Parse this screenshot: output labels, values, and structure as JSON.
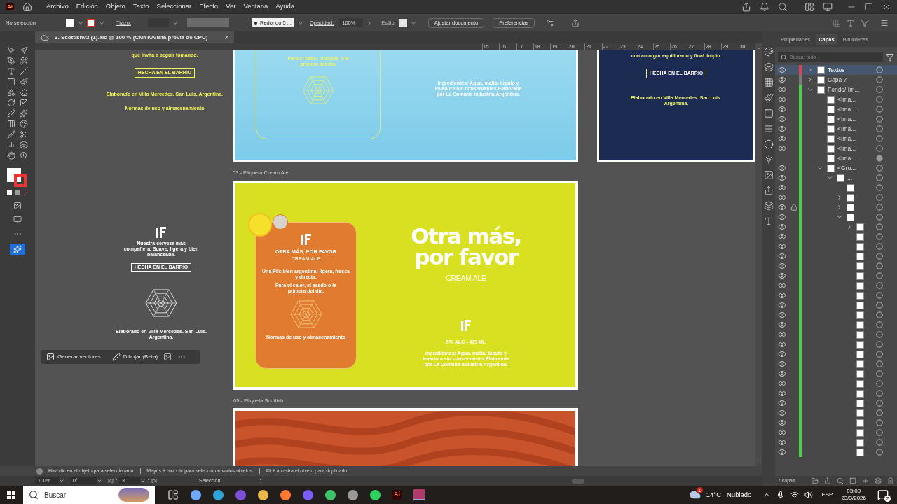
{
  "app_logo": "Ai",
  "menu": [
    "Archivo",
    "Edición",
    "Objeto",
    "Texto",
    "Seleccionar",
    "Efecto",
    "Ver",
    "Ventana",
    "Ayuda"
  ],
  "control_bar": {
    "selection": "No selección",
    "stroke_label": "Trazo:",
    "brush": "Redondo 5 ...",
    "opacity_label": "Opacidad:",
    "opacity": "100%",
    "style_label": "Estilo:",
    "buttons": [
      "Ajustar documento",
      "Preferencias"
    ]
  },
  "document_tab": {
    "title": "3. Scottishv2 (1).aic @ 100 % (CMYK/Vista previa de CPU)",
    "close": "×"
  },
  "ruler": [
    "15",
    "16",
    "17",
    "18",
    "19",
    "20",
    "21",
    "22",
    "23",
    "24",
    "25",
    "26",
    "27",
    "28",
    "29",
    "30"
  ],
  "canvas": {
    "side_top": {
      "tagline": "que invita a seguir tomando.",
      "badge": "HECHA EN EL BARRIO",
      "origin": "Elaborado en Villa Mercedes. San Luis. Argentina.",
      "storage_title": "Normas de uso y almacenamiento"
    },
    "side_bottom": {
      "lines": "Nuestra cerveza más compañera. Suave, ligera y bien balanceada.",
      "badge": "HECHA EN EL BARRIO",
      "origin": "Elaborado en Villa Mercedes. San Luis. Argentina."
    },
    "sky": {
      "card_text": "Para el calor, el asado o la primera del día.",
      "ingredients": "Ingredientes: Agua, malta, lúpulo y levadura sin conservantes Elaborada por La Comuna Industria Argentina."
    },
    "night": {
      "tagline": "con amargor equilibrado y final limpio.",
      "badge": "HECHA EN EL BARRIO",
      "origin": "Elaborado en Villa Mercedes. San Luis. Argentina."
    },
    "artboard_labels": [
      "03 - Etiqueta Cream Ale",
      "05 - Etiqueta Scottish"
    ],
    "cream_ale": {
      "card_title": "OTRA MÁS, POR FAVOR",
      "card_subtitle": "CREAM ALE",
      "description": "Una Pils bien argentina: ligera, fresca y directa.",
      "pairing": "Para el calor, el asado o la primera del día.",
      "storage_title": "Normas de uso y almacenamiento",
      "headline": "Otra más, por favor",
      "style": "CREAM ALE",
      "specs": "5% ALC • 473 ML",
      "ingredients": "Ingredientes: Agua, malta, lúpulo y levadura sin conservantes Elaborada por La Comuna Industria Argentina."
    }
  },
  "task_bar": {
    "generate": "Generar vectores",
    "draw": "Dibujar (Beta)"
  },
  "panel": {
    "tabs": [
      {
        "label": "Propiedades",
        "selected": false
      },
      {
        "label": "Capas",
        "selected": true
      },
      {
        "label": "Bibliotecas",
        "selected": false
      }
    ],
    "search": {
      "placeholder": "Buscar todo"
    },
    "layers": [
      {
        "name": "Textos",
        "color": "#d9434f",
        "selected": true,
        "visible": true,
        "locked": false,
        "expanded": false
      },
      {
        "name": "Capa 7",
        "color": "#7a7a7a",
        "selected": false,
        "visible": true,
        "locked": false,
        "expanded": false
      },
      {
        "name": "Fondo/ Im...",
        "color": "#4cd14c",
        "selected": false,
        "visible": true,
        "locked": false,
        "expanded": true,
        "children": [
          {
            "name": "<Ima...",
            "selected": false,
            "visible": true,
            "locked": false
          },
          {
            "name": "<Ima...",
            "selected": false,
            "visible": true,
            "locked": false
          },
          {
            "name": "<Ima...",
            "selected": false,
            "visible": true,
            "locked": false
          },
          {
            "name": "<Ima...",
            "selected": false,
            "visible": true,
            "locked": false
          },
          {
            "name": "<Ima...",
            "selected": false,
            "visible": true,
            "locked": false
          },
          {
            "name": "<Ima...",
            "selected": false,
            "visible": true,
            "locked": false
          },
          {
            "name": "<Ima...",
            "selected": false,
            "visible": false,
            "locked": false
          },
          {
            "name": "<Gru...",
            "selected": false,
            "visible": true,
            "locked": false,
            "expanded": true,
            "children": [
              {
                "name": "...",
                "selected": false,
                "visible": true,
                "locked": false,
                "expanded": true,
                "children": [
                  {
                    "selected": false,
                    "visible": true,
                    "locked": false
                  },
                  {
                    "selected": false,
                    "visible": true,
                    "locked": false,
                    "expanded": false
                  },
                  {
                    "selected": false,
                    "visible": true,
                    "locked": true,
                    "expanded": false
                  },
                  {
                    "selected": false,
                    "visible": true,
                    "locked": false,
                    "expanded": true,
                    "children": [
                      {
                        "selected": false,
                        "visible": true,
                        "locked": false,
                        "expanded": false
                      },
                      {
                        "selected": false,
                        "visible": true,
                        "locked": false
                      },
                      {
                        "selected": false,
                        "visible": true,
                        "locked": false
                      },
                      {
                        "selected": false,
                        "visible": true,
                        "locked": false
                      },
                      {
                        "selected": false,
                        "visible": true,
                        "locked": false
                      },
                      {
                        "selected": false,
                        "visible": true,
                        "locked": false
                      },
                      {
                        "selected": false,
                        "visible": true,
                        "locked": false
                      },
                      {
                        "selected": false,
                        "visible": true,
                        "locked": false
                      },
                      {
                        "selected": false,
                        "visible": true,
                        "locked": false
                      },
                      {
                        "selected": false,
                        "visible": true,
                        "locked": false
                      },
                      {
                        "selected": false,
                        "visible": true,
                        "locked": false
                      },
                      {
                        "selected": false,
                        "visible": true,
                        "locked": false
                      },
                      {
                        "selected": false,
                        "visible": true,
                        "locked": false
                      },
                      {
                        "selected": false,
                        "visible": true,
                        "locked": false
                      },
                      {
                        "selected": false,
                        "visible": true,
                        "locked": false
                      },
                      {
                        "selected": false,
                        "visible": true,
                        "locked": false
                      },
                      {
                        "selected": false,
                        "visible": true,
                        "locked": false
                      },
                      {
                        "selected": false,
                        "visible": true,
                        "locked": false
                      },
                      {
                        "selected": false,
                        "visible": true,
                        "locked": false
                      },
                      {
                        "selected": false,
                        "visible": true,
                        "locked": false
                      },
                      {
                        "selected": false,
                        "visible": true,
                        "locked": false
                      },
                      {
                        "selected": false,
                        "visible": true,
                        "locked": false
                      },
                      {
                        "selected": false,
                        "visible": true,
                        "locked": false
                      },
                      {
                        "selected": false,
                        "visible": true,
                        "locked": false
                      }
                    ]
                  }
                ]
              }
            ]
          }
        ]
      }
    ],
    "footer": "7 capas"
  },
  "status": {
    "hints": [
      "Haz clic en el objeto para seleccionarlo.",
      "Mayús + haz clic para seleccionar varios objetos.",
      "Alt + arrastra el objeto para duplicarlo."
    ],
    "zoom": "100%",
    "rotation": "0°",
    "artboard": "3",
    "tool": "Selección"
  },
  "taskbar": {
    "search": {
      "placeholder": "Buscar"
    },
    "app_label": "Ai",
    "weather_badge": "1",
    "temperature": "14°C",
    "weather": "Nublado",
    "language": "ESP",
    "time": "03:09",
    "date": "23/3/2026",
    "notifications": "2"
  }
}
